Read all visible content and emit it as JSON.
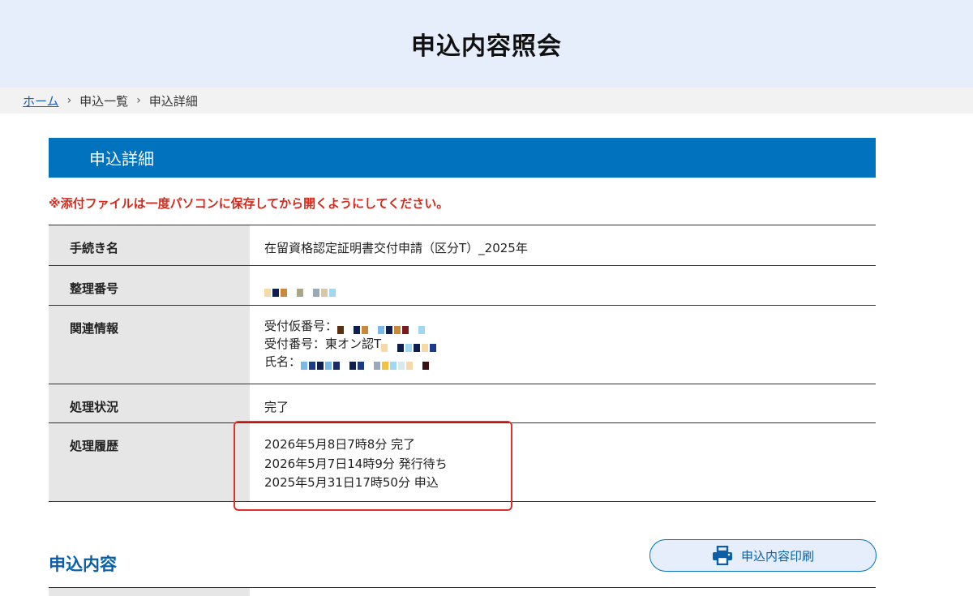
{
  "header": {
    "title": "申込内容照会"
  },
  "breadcrumb": {
    "home": "ホーム",
    "sep": "›",
    "list": "申込一覧",
    "current": "申込詳細"
  },
  "section": {
    "title": "申込詳細"
  },
  "notice": "※添付ファイルは一度パソコンに保存してから開くようにしてください。",
  "details": {
    "procedure": {
      "label": "手続き名",
      "value": "在留資格認定証明書交付申請（区分T）_2025年"
    },
    "ref_number": {
      "label": "整理番号"
    },
    "related": {
      "label": "関連情報",
      "temp_number_label": "受付仮番号：",
      "receipt_number_label": "受付番号：東オン認T",
      "name_label": "氏名："
    },
    "status": {
      "label": "処理状況",
      "value": "完了"
    },
    "history": {
      "label": "処理履歴",
      "entries": [
        "2026年5月8日7時8分 完了",
        "2026年5月7日14時9分 発行待ち",
        "2025年5月31日17時50分 申込"
      ]
    }
  },
  "content_section": {
    "title": "申込内容"
  },
  "print_button": {
    "label": "申込内容印刷",
    "icon": "printer-icon"
  },
  "colors": {
    "header_bg": "#e5eefa",
    "section_bar": "#0072be",
    "notice": "#d42b1e",
    "highlight": "#e0302a"
  }
}
